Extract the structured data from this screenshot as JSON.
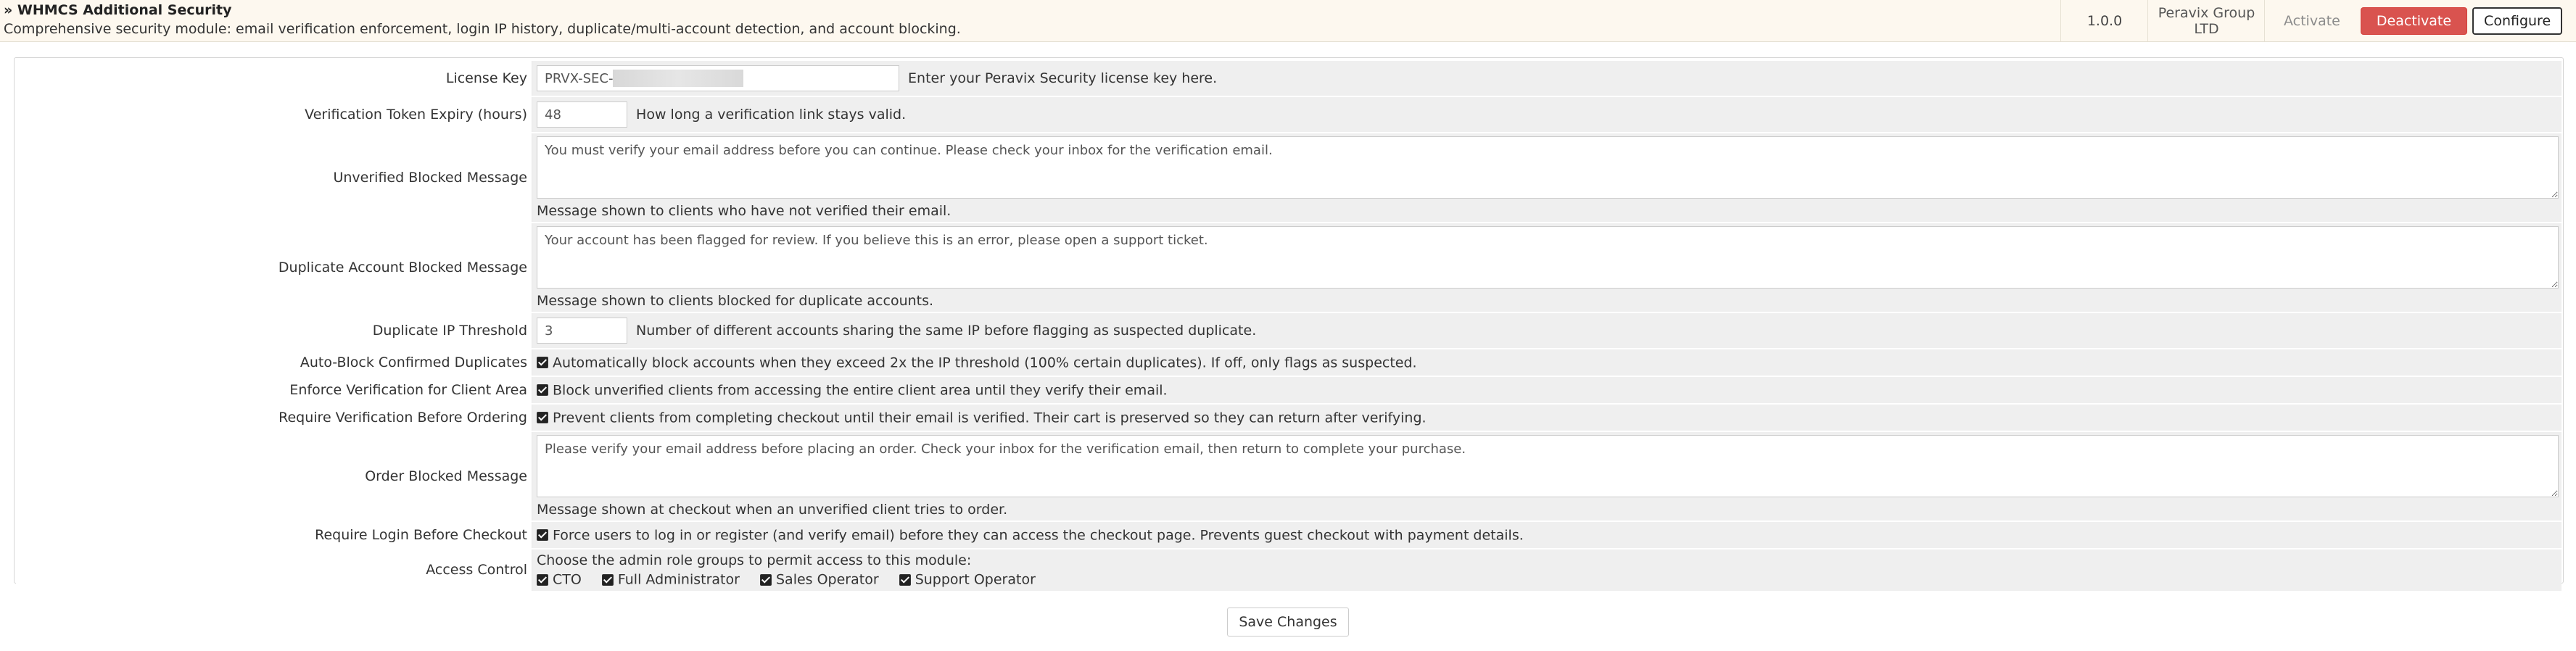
{
  "module": {
    "title": "» WHMCS Additional Security",
    "description": "Comprehensive security module: email verification enforcement, login IP history, duplicate/multi-account detection, and account blocking.",
    "version": "1.0.0",
    "author_line1": "Peravix Group",
    "author_line2": "LTD",
    "activate_label": "Activate",
    "deactivate_label": "Deactivate",
    "configure_label": "Configure"
  },
  "settings": {
    "license_key": {
      "label": "License Key",
      "value_prefix": "PRVX-SEC-",
      "hint": "Enter your Peravix Security license key here."
    },
    "token_expiry": {
      "label": "Verification Token Expiry (hours)",
      "value": "48",
      "hint": "How long a verification link stays valid."
    },
    "unverified_msg": {
      "label": "Unverified Blocked Message",
      "value": "You must verify your email address before you can continue. Please check your inbox for the verification email.",
      "hint": "Message shown to clients who have not verified their email."
    },
    "duplicate_msg": {
      "label": "Duplicate Account Blocked Message",
      "value": "Your account has been flagged for review. If you believe this is an error, please open a support ticket.",
      "hint": "Message shown to clients blocked for duplicate accounts."
    },
    "dup_threshold": {
      "label": "Duplicate IP Threshold",
      "value": "3",
      "hint": "Number of different accounts sharing the same IP before flagging as suspected duplicate."
    },
    "auto_block": {
      "label": "Auto-Block Confirmed Duplicates",
      "checked": true,
      "text": "Automatically block accounts when they exceed 2x the IP threshold (100% certain duplicates). If off, only flags as suspected."
    },
    "enforce_client_area": {
      "label": "Enforce Verification for Client Area",
      "checked": true,
      "text": "Block unverified clients from accessing the entire client area until they verify their email."
    },
    "require_before_order": {
      "label": "Require Verification Before Ordering",
      "checked": true,
      "text": "Prevent clients from completing checkout until their email is verified. Their cart is preserved so they can return after verifying."
    },
    "order_msg": {
      "label": "Order Blocked Message",
      "value": "Please verify your email address before placing an order. Check your inbox for the verification email, then return to complete your purchase.",
      "hint": "Message shown at checkout when an unverified client tries to order."
    },
    "login_before_checkout": {
      "label": "Require Login Before Checkout",
      "checked": true,
      "text": "Force users to log in or register (and verify email) before they can access the checkout page. Prevents guest checkout with payment details."
    },
    "access_control": {
      "label": "Access Control",
      "intro": "Choose the admin role groups to permit access to this module:",
      "roles": [
        {
          "name": "CTO",
          "checked": true
        },
        {
          "name": "Full Administrator",
          "checked": true
        },
        {
          "name": "Sales Operator",
          "checked": true
        },
        {
          "name": "Support Operator",
          "checked": true
        }
      ]
    }
  },
  "save_label": "Save Changes",
  "colors": {
    "danger": "#d9534f",
    "header_bg": "#fdf8ef",
    "row_bg": "#efefef"
  }
}
